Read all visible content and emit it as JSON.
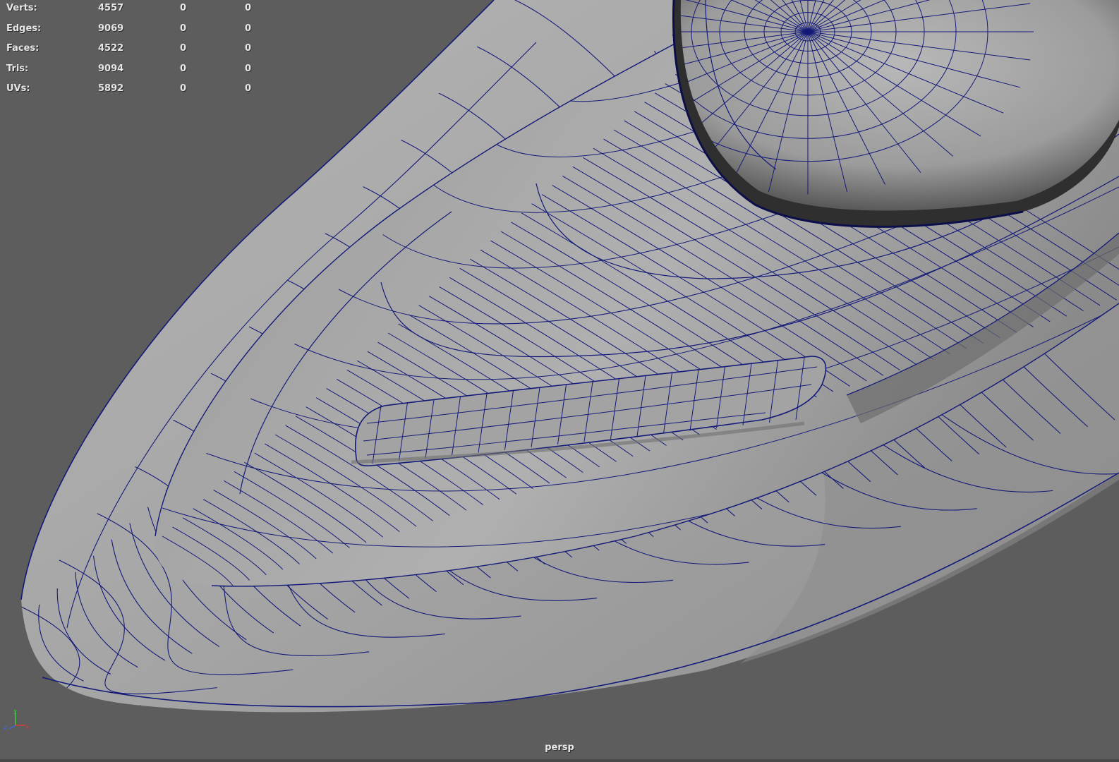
{
  "viewport": {
    "camera_name": "persp",
    "colors": {
      "background": "#5d5d5d",
      "surface": "#a9a9a9",
      "wireframe": "#141a78"
    }
  },
  "poly_count": {
    "rows": [
      {
        "label": "Verts:",
        "total": "4557",
        "selected": "0",
        "selected_faces": "0"
      },
      {
        "label": "Edges:",
        "total": "9069",
        "selected": "0",
        "selected_faces": "0"
      },
      {
        "label": "Faces:",
        "total": "4522",
        "selected": "0",
        "selected_faces": "0"
      },
      {
        "label": "Tris:",
        "total": "9094",
        "selected": "0",
        "selected_faces": "0"
      },
      {
        "label": "UVs:",
        "total": "5892",
        "selected": "0",
        "selected_faces": "0"
      }
    ]
  },
  "axis_gizmo": {
    "y_label": "y",
    "z_label": "z",
    "x_label": "x",
    "colors": {
      "x": "#e23a3a",
      "y": "#3ad23a",
      "z": "#3a6ae2"
    }
  }
}
